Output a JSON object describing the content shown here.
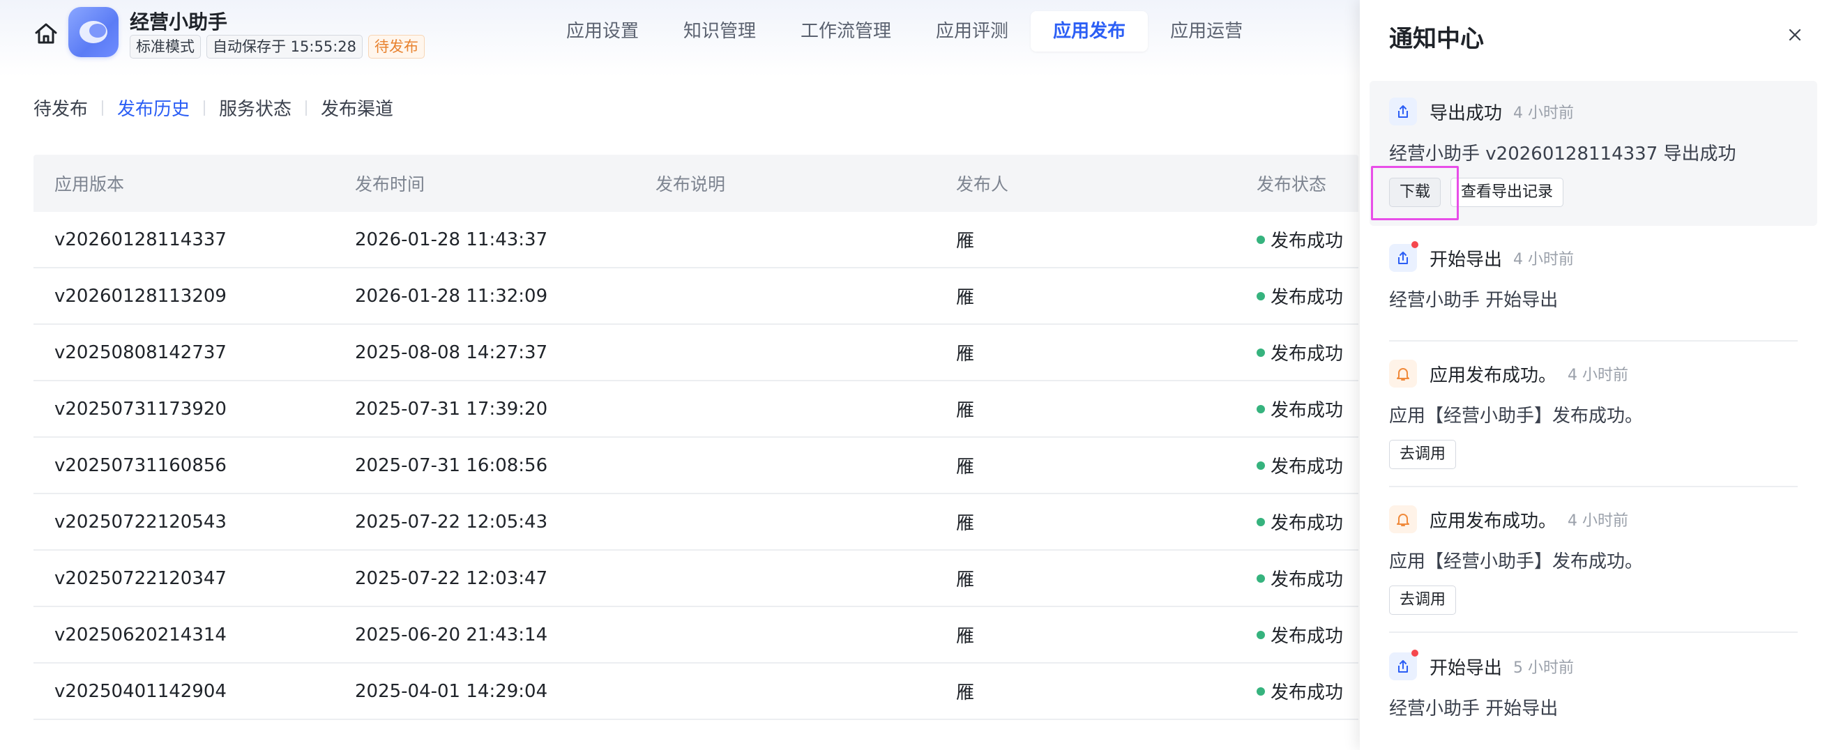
{
  "header": {
    "app_name": "经营小助手",
    "tags": [
      "标准模式",
      "自动保存于 15:55:28",
      "待发布"
    ],
    "nav": [
      "应用设置",
      "知识管理",
      "工作流管理",
      "应用评测",
      "应用发布",
      "应用运营"
    ],
    "active_nav": "应用发布"
  },
  "sub_tabs": [
    "待发布",
    "发布历史",
    "服务状态",
    "发布渠道"
  ],
  "active_sub_tab": "发布历史",
  "table": {
    "columns": [
      "应用版本",
      "发布时间",
      "发布说明",
      "发布人",
      "发布状态"
    ],
    "rows": [
      {
        "version": "v20260128114337",
        "time": "2026-01-28 11:43:37",
        "note": "",
        "publisher": "雁",
        "status": "发布成功"
      },
      {
        "version": "v20260128113209",
        "time": "2026-01-28 11:32:09",
        "note": "",
        "publisher": "雁",
        "status": "发布成功"
      },
      {
        "version": "v20250808142737",
        "time": "2025-08-08 14:27:37",
        "note": "",
        "publisher": "雁",
        "status": "发布成功"
      },
      {
        "version": "v20250731173920",
        "time": "2025-07-31 17:39:20",
        "note": "",
        "publisher": "雁",
        "status": "发布成功"
      },
      {
        "version": "v20250731160856",
        "time": "2025-07-31 16:08:56",
        "note": "",
        "publisher": "雁",
        "status": "发布成功"
      },
      {
        "version": "v20250722120543",
        "time": "2025-07-22 12:05:43",
        "note": "",
        "publisher": "雁",
        "status": "发布成功"
      },
      {
        "version": "v20250722120347",
        "time": "2025-07-22 12:03:47",
        "note": "",
        "publisher": "雁",
        "status": "发布成功"
      },
      {
        "version": "v20250620214314",
        "time": "2025-06-20 21:43:14",
        "note": "",
        "publisher": "雁",
        "status": "发布成功"
      },
      {
        "version": "v20250401142904",
        "time": "2025-04-01 14:29:04",
        "note": "",
        "publisher": "雁",
        "status": "发布成功"
      }
    ]
  },
  "notifications": {
    "title": "通知中心",
    "items": [
      {
        "icon": "export-icon",
        "title": "导出成功",
        "time": "4 小时前",
        "body": "经营小助手 v20260128114337 导出成功",
        "actions": [
          "下载",
          "查看导出记录"
        ],
        "unread": false
      },
      {
        "icon": "export-icon",
        "title": "开始导出",
        "time": "4 小时前",
        "body": "经营小助手 开始导出",
        "actions": [],
        "unread": true
      },
      {
        "icon": "bell-icon",
        "title": "应用发布成功。",
        "time": "4 小时前",
        "body": "应用【经营小助手】发布成功。",
        "actions": [
          "去调用"
        ],
        "unread": false
      },
      {
        "icon": "bell-icon",
        "title": "应用发布成功。",
        "time": "4 小时前",
        "body": "应用【经营小助手】发布成功。",
        "actions": [
          "去调用"
        ],
        "unread": false
      },
      {
        "icon": "export-icon",
        "title": "开始导出",
        "time": "5 小时前",
        "body": "经营小助手 开始导出",
        "actions": [],
        "unread": true
      }
    ]
  },
  "colors": {
    "accent": "#2b5ef5",
    "success": "#36b37e",
    "pending": "#e8822f",
    "highlight_box": "#e84ee8"
  }
}
